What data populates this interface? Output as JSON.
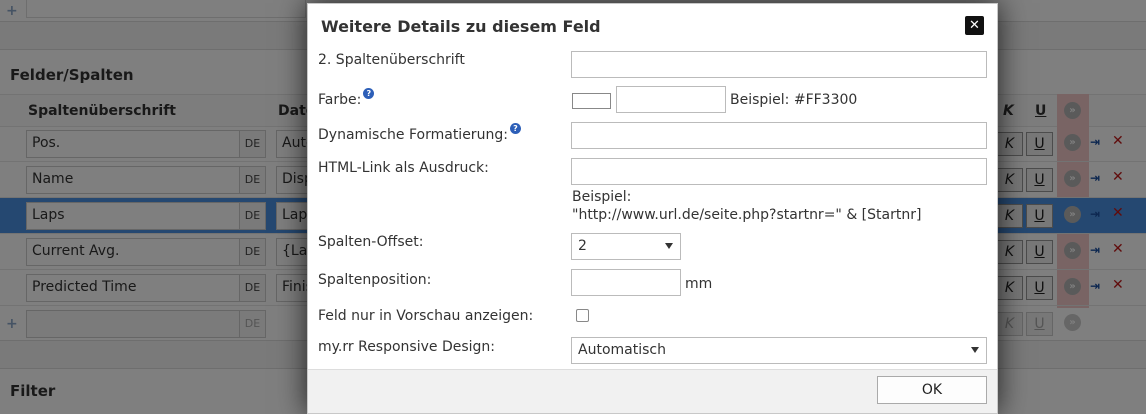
{
  "background": {
    "fields_panel": {
      "title": "Felder/Spalten",
      "col_header_name": "Spaltenüberschrift",
      "col_header_data": "Date",
      "col_header_k": "K",
      "col_header_u": "U",
      "lang_label": "DE",
      "rows": [
        {
          "name": "Pos.",
          "data": "Auto",
          "selected": false
        },
        {
          "name": "Name",
          "data": "Displ",
          "selected": false
        },
        {
          "name": "Laps",
          "data": "Laps",
          "selected": true
        },
        {
          "name": "Current Avg.",
          "data": "{Las",
          "selected": false
        },
        {
          "name": "Predicted Time",
          "data": "Finis",
          "selected": false
        }
      ]
    },
    "filter_panel": {
      "title": "Filter"
    }
  },
  "dialog": {
    "title": "Weitere Details zu diesem Feld",
    "close_symbol": "✕",
    "heading2": {
      "label": "2. Spaltenüberschrift",
      "value": ""
    },
    "color": {
      "label": "Farbe:",
      "value": "",
      "example": "Beispiel: #FF3300"
    },
    "dynamic_format": {
      "label": "Dynamische Formatierung:",
      "value": ""
    },
    "html_link": {
      "label": "HTML-Link als Ausdruck:",
      "value": "",
      "example_title": "Beispiel:",
      "example_text": "\"http://www.url.de/seite.php?startnr=\" & [Startnr]"
    },
    "column_offset": {
      "label": "Spalten-Offset:",
      "value": "2"
    },
    "column_position": {
      "label": "Spaltenposition:",
      "value": "",
      "unit": "mm"
    },
    "preview_only": {
      "label": "Feld nur in Vorschau anzeigen:",
      "checked": false
    },
    "responsive": {
      "label": "my.rr Responsive Design:",
      "value": "Automatisch"
    },
    "ok_label": "OK",
    "help_symbol": "?"
  },
  "icons": {
    "help": "question-circle-icon",
    "close": "close-icon",
    "go": "arrow-circle-icon",
    "move": "move-column-icon",
    "delete": "delete-icon",
    "add": "add-row-icon"
  },
  "colors": {
    "selected_row": "#4a90e2",
    "pink_column": "#f3c9c9",
    "help_icon": "#2d5fb8",
    "delete_icon": "#c01818"
  }
}
